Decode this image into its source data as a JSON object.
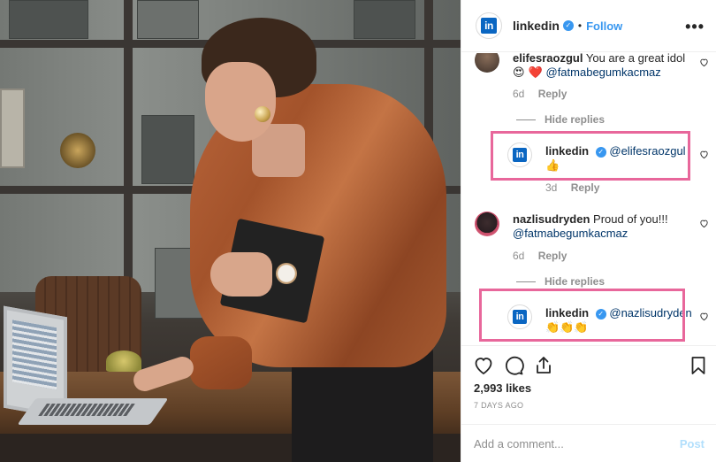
{
  "header": {
    "username": "linkedin",
    "separator": "•",
    "follow_label": "Follow",
    "more_label": "•••",
    "logo_text": "in"
  },
  "comments": [
    {
      "username": "elifesraozgul",
      "text": "You are a great idol",
      "emoji": "😍 ❤️",
      "mention": "@fatmabegumkacmaz",
      "time": "6d",
      "reply_label": "Reply"
    },
    {
      "username": "linkedin",
      "mention": "@elifesraozgul",
      "emoji": "👍",
      "time": "3d",
      "reply_label": "Reply"
    },
    {
      "username": "nazlisudryden",
      "text": "Proud of you!!!",
      "mention": "@fatmabegumkacmaz",
      "time": "6d",
      "reply_label": "Reply"
    },
    {
      "username": "linkedin",
      "mention": "@nazlisudryden",
      "emoji": "👏👏👏"
    }
  ],
  "hide_replies_label": "Hide replies",
  "likes": "2,993 likes",
  "date": "7 DAYS AGO",
  "add_comment": {
    "placeholder": "Add a comment...",
    "post_label": "Post"
  },
  "colors": {
    "link_blue": "#3897f0",
    "highlight_pink": "#e8679b",
    "linkedin_blue": "#0a66c2",
    "muted_gray": "#8e8e8e"
  },
  "icons": [
    "heart-icon",
    "comment-icon",
    "share-icon",
    "bookmark-icon",
    "more-options-icon",
    "verified-badge-icon"
  ]
}
